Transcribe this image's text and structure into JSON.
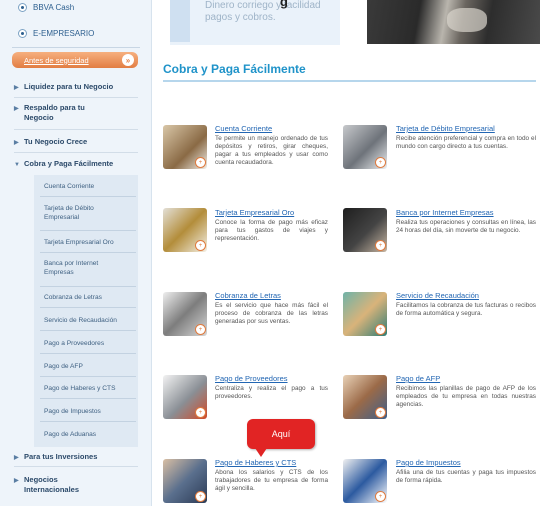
{
  "sidebar": {
    "radio_1": "BBVA Cash",
    "radio_2": "E-EMPRESARIO",
    "login_button": "Antes de seguridad",
    "login_badge": "»",
    "nav": [
      "Liquidez para tu Negocio",
      "Respaldo para tu Negocio",
      "Tu Negocio Crece",
      "Cobra y Paga Fácilmente",
      "Para tus Inversiones",
      "Negocios Internacionales"
    ],
    "sub": [
      "Cuenta Corriente",
      "Tarjeta de Débito Empresarial",
      "Tarjeta Empresarial Oro",
      "Banca por Internet Empresas",
      "Cobranza de Letras",
      "Servicio de Recaudación",
      "Pago a Proveedores",
      "Pago de AFP",
      "Pago de Haberes y CTS",
      "Pago de Impuestos",
      "Pago de Aduanas"
    ]
  },
  "header": {
    "blurb": "Dinero corriego y facilidad pagos y cobros.",
    "partial_title": "g"
  },
  "main": {
    "title": "Cobra y Paga Fácilmente",
    "tooltip": "Aquí",
    "cards": [
      {
        "title": "Cuenta Corriente",
        "desc": "Te permite un manejo ordenado de tus depósitos y retiros, girar cheques, pagar a tus empleados y usar como cuenta recaudadora."
      },
      {
        "title": "Tarjeta de Débito Empresarial",
        "desc": "Recibe atención preferencial y compra en todo el mundo con cargo directo a tus cuentas."
      },
      {
        "title": "Tarjeta Empresarial Oro",
        "desc": "Conoce la forma de pago más eficaz para tus gastos de viajes y representación."
      },
      {
        "title": "Banca por Internet Empresas",
        "desc": "Realiza tus operaciones y consultas en línea, las 24 horas del día, sin moverte de tu negocio."
      },
      {
        "title": "Cobranza de Letras",
        "desc": "Es el servicio que hace más fácil el proceso de cobranza de las letras generadas por sus ventas."
      },
      {
        "title": "Servicio de Recaudación",
        "desc": "Facilitamos la cobranza de tus facturas o recibos de forma automática y segura."
      },
      {
        "title": "Pago de Proveedores",
        "desc": "Centraliza y realiza el pago a tus proveedores."
      },
      {
        "title": "Pago de AFP",
        "desc": "Recibimos las planillas de pago de AFP de los empleados de tu empresa en todas nuestras agencias."
      },
      {
        "title": "Pago de Haberes y CTS",
        "desc": "Abona los salarios y CTS de los trabajadores de tu empresa de forma ágil y sencilla."
      },
      {
        "title": "Pago de Impuestos",
        "desc": "Afilia una de tus cuentas y paga tus impuestos de forma rápida."
      }
    ]
  },
  "colors": {
    "accent": "#1f93c9",
    "link": "#2266b3",
    "tooltip_red": "#e12424",
    "login_orange": "#e27d43"
  }
}
